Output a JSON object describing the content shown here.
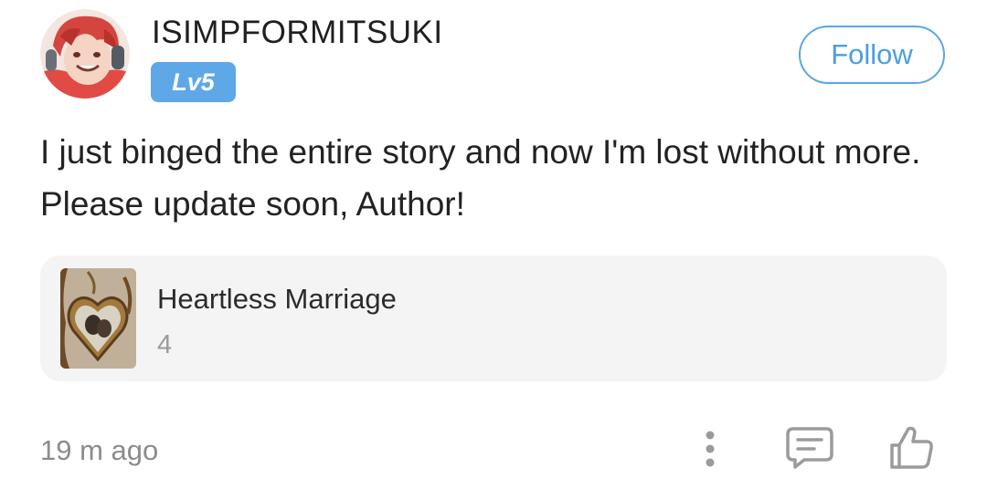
{
  "user": {
    "name": "ISIMPFORMITSUKI",
    "level": "Lv5"
  },
  "follow_button": {
    "label": "Follow"
  },
  "comment": {
    "text": "I just binged the entire story and now I'm lost without more. Please update soon, Author!"
  },
  "book": {
    "title": "Heartless Marriage",
    "count": "4"
  },
  "footer": {
    "timestamp": "19 m ago"
  },
  "colors": {
    "accent": "#5aa7e6",
    "badge": "#5fa8e8",
    "card_bg": "#f4f4f4",
    "muted_text": "#8c8c8c"
  },
  "icons": {
    "more": "more-vertical-icon",
    "reply": "comment-icon",
    "like": "thumbs-up-icon"
  }
}
